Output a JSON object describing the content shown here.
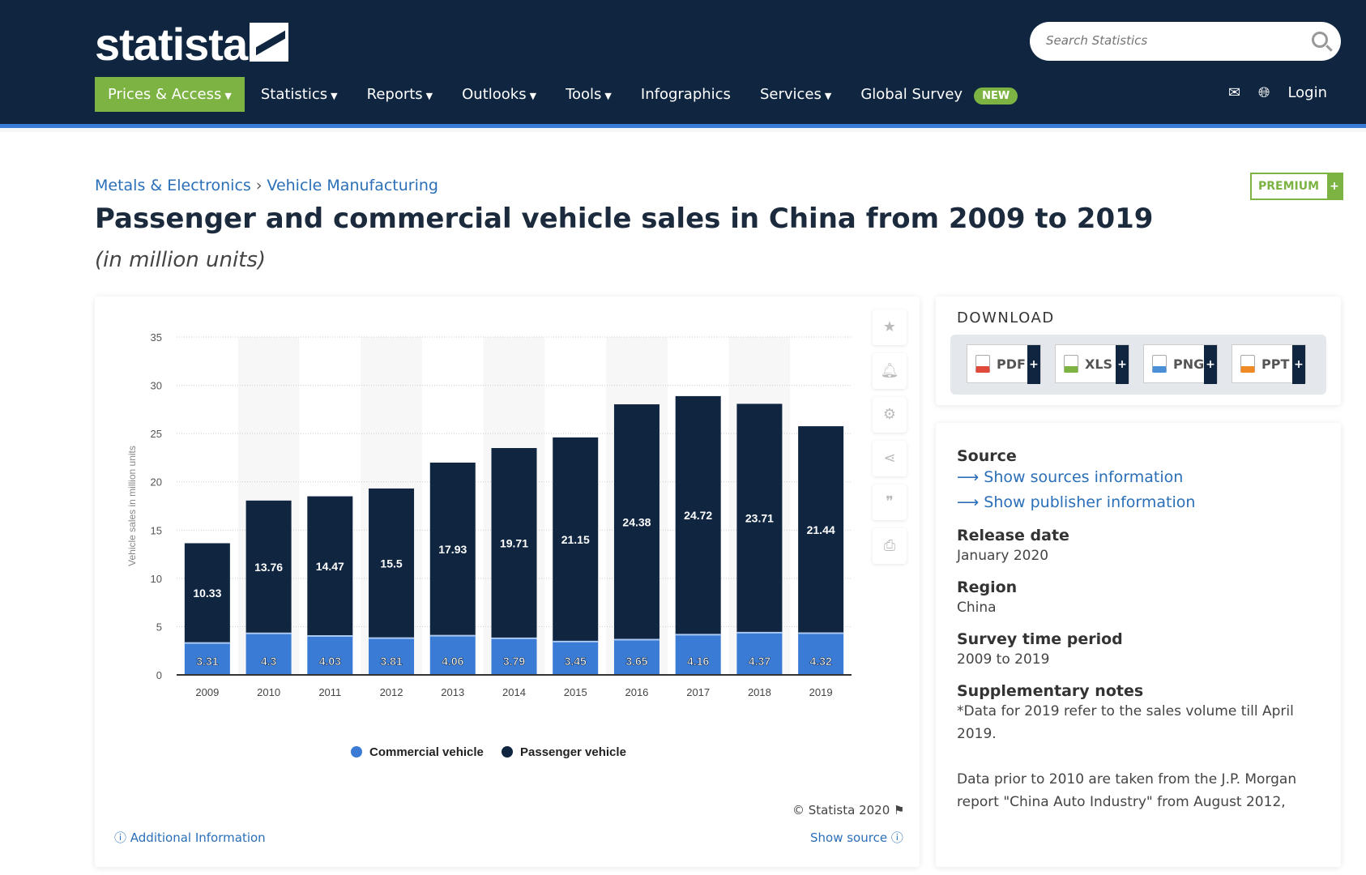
{
  "header": {
    "logo": "statista",
    "search_placeholder": "Search Statistics",
    "nav": [
      {
        "label": "Prices & Access",
        "caret": true
      },
      {
        "label": "Statistics",
        "caret": true
      },
      {
        "label": "Reports",
        "caret": true
      },
      {
        "label": "Outlooks",
        "caret": true
      },
      {
        "label": "Tools",
        "caret": true
      },
      {
        "label": "Infographics",
        "caret": false
      },
      {
        "label": "Services",
        "caret": true
      },
      {
        "label": "Global Survey",
        "caret": false
      }
    ],
    "new_badge": "NEW",
    "login": "Login"
  },
  "breadcrumb": [
    "Metals & Electronics",
    "Vehicle Manufacturing"
  ],
  "premium": "PREMIUM",
  "title": "Passenger and commercial vehicle sales in China from 2009 to 2019",
  "subtitle": "(in million units)",
  "chart_data": {
    "type": "bar",
    "stacked": true,
    "ylabel": "Vehicle sales in million units",
    "ylim": [
      0,
      35
    ],
    "yticks": [
      0,
      5,
      10,
      15,
      20,
      25,
      30,
      35
    ],
    "grid": true,
    "legend_placement": "bottom",
    "categories": [
      "2009",
      "2010",
      "2011",
      "2012",
      "2013",
      "2014",
      "2015",
      "2016",
      "2017",
      "2018",
      "2019"
    ],
    "series": [
      {
        "name": "Commercial vehicle",
        "color": "#3a7bd5",
        "values": [
          3.31,
          4.3,
          4.03,
          3.81,
          4.06,
          3.79,
          3.45,
          3.65,
          4.16,
          4.37,
          4.32
        ]
      },
      {
        "name": "Passenger vehicle",
        "color": "#0f2540",
        "values": [
          10.33,
          13.76,
          14.47,
          15.5,
          17.93,
          19.71,
          21.15,
          24.38,
          24.72,
          23.71,
          21.44
        ]
      }
    ]
  },
  "chart_footer": {
    "copyright": "© Statista 2020",
    "additional_info": "Additional Information",
    "show_source": "Show source"
  },
  "download": {
    "title": "DOWNLOAD",
    "formats": [
      "PDF",
      "XLS",
      "PNG",
      "PPT"
    ]
  },
  "info": {
    "source_label": "Source",
    "source_links": [
      "Show sources information",
      "Show publisher information"
    ],
    "release_label": "Release date",
    "release": "January 2020",
    "region_label": "Region",
    "region": "China",
    "period_label": "Survey time period",
    "period": "2009 to 2019",
    "notes_label": "Supplementary notes",
    "note1": "*Data for 2019 refer to the sales volume till April 2019.",
    "note2": "Data prior to 2010 are taken from the J.P. Morgan report \"China Auto Industry\" from August 2012,"
  }
}
